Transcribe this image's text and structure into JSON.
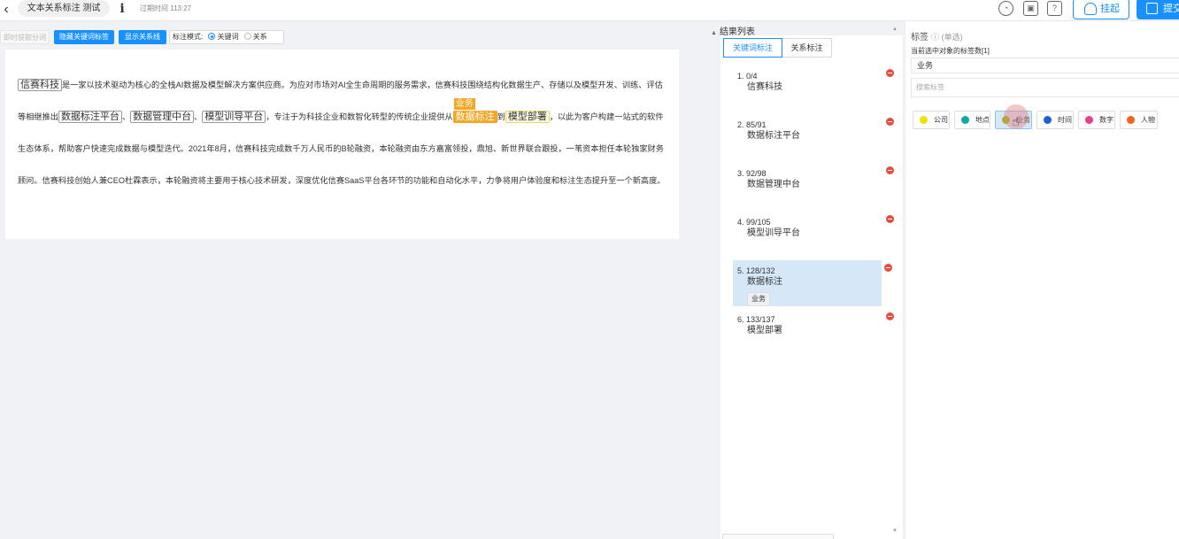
{
  "header": {
    "back_icon": "chevron-left-icon",
    "task_name": "文本关系标注 测试",
    "info_icon": "info-icon",
    "expire": "过期时间 113:27",
    "icons": [
      "dashboard-icon",
      "save-icon",
      "help-icon"
    ],
    "hang_label": "挂起",
    "submit_label": "提交"
  },
  "toolbar": {
    "auto_segment": "即时获取分词",
    "hide_labels": "隐藏关键词标签",
    "show_relations": "显示关系线",
    "mode_label": "标注模式:",
    "mode_keyword": "关键词",
    "mode_relation": "关系",
    "selected_mode": "关键词"
  },
  "document": {
    "e1": "信赛科技",
    "t1": "是一家以技术驱动为核心的全栈AI数据及模型解决方案供应商。为应对市场对AI全生命周期的服务需求，信赛科技围绕结构化数据生产、存储以及模型开发、训练、评估等相继推出",
    "e2": "数据标注平台",
    "t2": "、",
    "e3": "数据管理中台",
    "t3": "、",
    "e4": "模型训导平台",
    "t4": "，专注于为科技企业和数智化转型的传统企业提供从",
    "e5": "数据标注",
    "e5_label": "业务",
    "t5": "到",
    "e6": "模型部署",
    "t6": "，以此为客户构建一站式的软件生态体系，帮助客户快速完成数据与模型迭代。2021年8月，信赛科技完成数千万人民币的B轮融资，本轮融资由东方嘉富领投，鼎旭、新世界联合跟投，一苇资本担任本轮独家财务顾问。信赛科技创始人兼CEO杜霖表示，本轮融资将主要用于核心技术研发，深度优化信赛SaaS平台各环节的功能和自动化水平，力争将用户体验度和标注生态提升至一个新高度。"
  },
  "results": {
    "title": "结果列表",
    "tab_keyword": "关键词标注",
    "tab_relation": "关系标注",
    "items": [
      {
        "idx": "1.",
        "range": "0/4",
        "text": "信赛科技",
        "tag": ""
      },
      {
        "idx": "2.",
        "range": "85/91",
        "text": "数据标注平台",
        "tag": ""
      },
      {
        "idx": "3.",
        "range": "92/98",
        "text": "数据管理中台",
        "tag": ""
      },
      {
        "idx": "4.",
        "range": "99/105",
        "text": "模型训导平台",
        "tag": ""
      },
      {
        "idx": "5.",
        "range": "128/132",
        "text": "数据标注",
        "tag": "业务"
      },
      {
        "idx": "6.",
        "range": "133/137",
        "text": "模型部署",
        "tag": ""
      }
    ]
  },
  "labels": {
    "title": "标签",
    "single": "(单选)",
    "count_text": "当前选中对象的标签数[1]",
    "current": "业务",
    "search_placeholder": "搜索标签",
    "options": [
      {
        "name": "公司",
        "color": "#f5e100"
      },
      {
        "name": "地点",
        "color": "#13a8a8"
      },
      {
        "name": "业务",
        "color": "#a0b51a"
      },
      {
        "name": "时间",
        "color": "#1f5fd6"
      },
      {
        "name": "数字",
        "color": "#e83e8c"
      },
      {
        "name": "人物",
        "color": "#f0641e"
      }
    ],
    "selected": "业务"
  }
}
